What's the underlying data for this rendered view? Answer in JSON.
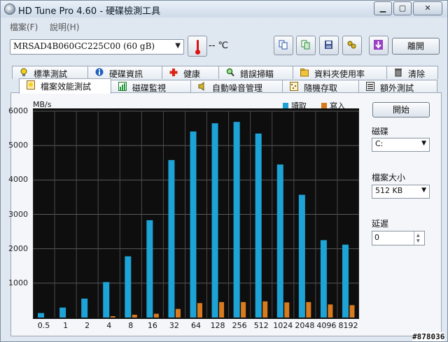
{
  "window": {
    "title": "HD Tune Pro 4.60 - 硬碟檢測工具",
    "minimize": "▁",
    "maximize": "▢",
    "close": "✕"
  },
  "menu": [
    "檔案(F)",
    "說明(H)"
  ],
  "toolbar": {
    "drive": "MRSAD4B060GC225C00      (60 gB)",
    "temperature": "-- ℃",
    "exit_label": "離開"
  },
  "tabs_row1": [
    "標準測試",
    "硬碟資訊",
    "健康",
    "錯誤掃瞄",
    "資料夾使用率",
    "清除"
  ],
  "tabs_row2": [
    "檔案效能測試",
    "磁碟監視",
    "自動噪音管理",
    "隨機存取",
    "額外測試"
  ],
  "chart_data": {
    "type": "bar",
    "ylabel": "MB/s",
    "y_tick_labels": [
      "6000",
      "5000",
      "4000",
      "3000",
      "2000",
      "1000"
    ],
    "y_ticks": [
      6000,
      5000,
      4000,
      3000,
      2000,
      1000
    ],
    "ylim": [
      0,
      6000
    ],
    "grid": true,
    "legend_position": "top-right",
    "categories": [
      "0.5",
      "1",
      "2",
      "4",
      "8",
      "16",
      "32",
      "64",
      "128",
      "256",
      "512",
      "1024",
      "2048",
      "4096",
      "8192"
    ],
    "series": [
      {
        "name": "讀取",
        "color": "#1ea3d6",
        "values": [
          130,
          290,
          550,
          1030,
          1780,
          2830,
          4580,
          5410,
          5650,
          5690,
          5350,
          4450,
          3570,
          2250,
          2120
        ]
      },
      {
        "name": "寫入",
        "color": "#d87a1e",
        "values": [
          0,
          0,
          0,
          40,
          80,
          110,
          250,
          420,
          450,
          450,
          470,
          440,
          450,
          380,
          360
        ]
      }
    ]
  },
  "side": {
    "start_label": "開始",
    "disk_label": "磁碟",
    "disk_value": "C:",
    "filesize_label": "檔案大小",
    "filesize_value": "512 KB",
    "delay_label": "延遲",
    "delay_value": "0"
  },
  "watermark": "#878036",
  "colors": {
    "read": "#1ea3d6",
    "write": "#d87a1e",
    "chart_bg": "#0e0e0e"
  }
}
